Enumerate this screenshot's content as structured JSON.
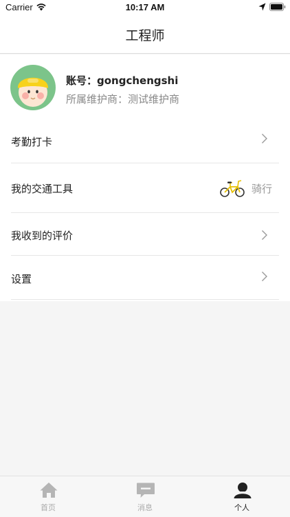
{
  "status_bar": {
    "carrier": "Carrier",
    "time": "10:17 AM"
  },
  "nav": {
    "title": "工程师"
  },
  "profile": {
    "account": "账号：gongchengshi",
    "vendor": "所属维护商：测试维护商"
  },
  "menu": {
    "attendance": "考勤打卡",
    "transport_label": "我的交通工具",
    "transport_value": "骑行",
    "reviews": "我收到的评价",
    "settings": "设置"
  },
  "tabs": [
    {
      "label": "首页",
      "icon": "home-icon",
      "active": false
    },
    {
      "label": "消息",
      "icon": "message-icon",
      "active": false
    },
    {
      "label": "个人",
      "icon": "person-icon",
      "active": true
    }
  ],
  "colors": {
    "inactive_tab": "#aaaaaa",
    "active_tab": "#222222",
    "bike_frame": "#e8c100"
  }
}
